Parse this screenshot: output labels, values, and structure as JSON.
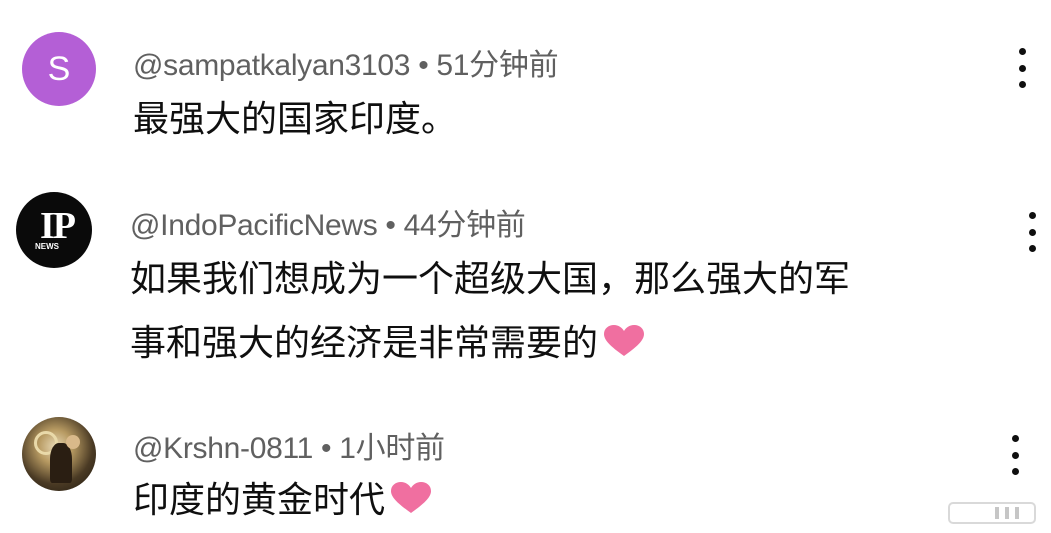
{
  "comments": [
    {
      "avatar_letter": "S",
      "avatar_color": "#b45fd6",
      "handle": "@sampatkalyan3103",
      "time": "51分钟前",
      "text_lines": [
        "最强大的国家印度。"
      ]
    },
    {
      "avatar_text": "IP",
      "avatar_subtext": "NEWS",
      "handle": "@IndoPacificNews",
      "time": "44分钟前",
      "text_lines": [
        "如果我们想成为一个超级大国，那么强大的军",
        "事和强大的经济是非常需要的"
      ],
      "emoji": "heart-emoji"
    },
    {
      "avatar": "photo",
      "handle": "@Krshn-0811",
      "time": "1小时前",
      "text_lines": [
        "印度的黄金时代"
      ],
      "emoji": "heart-emoji"
    }
  ],
  "separator": "•",
  "icons": {
    "more": "more-vert-icon",
    "heart": "heart-icon"
  },
  "colors": {
    "meta_text": "#606060",
    "body_text": "#0f0f0f",
    "heart": "#f06fa0"
  }
}
